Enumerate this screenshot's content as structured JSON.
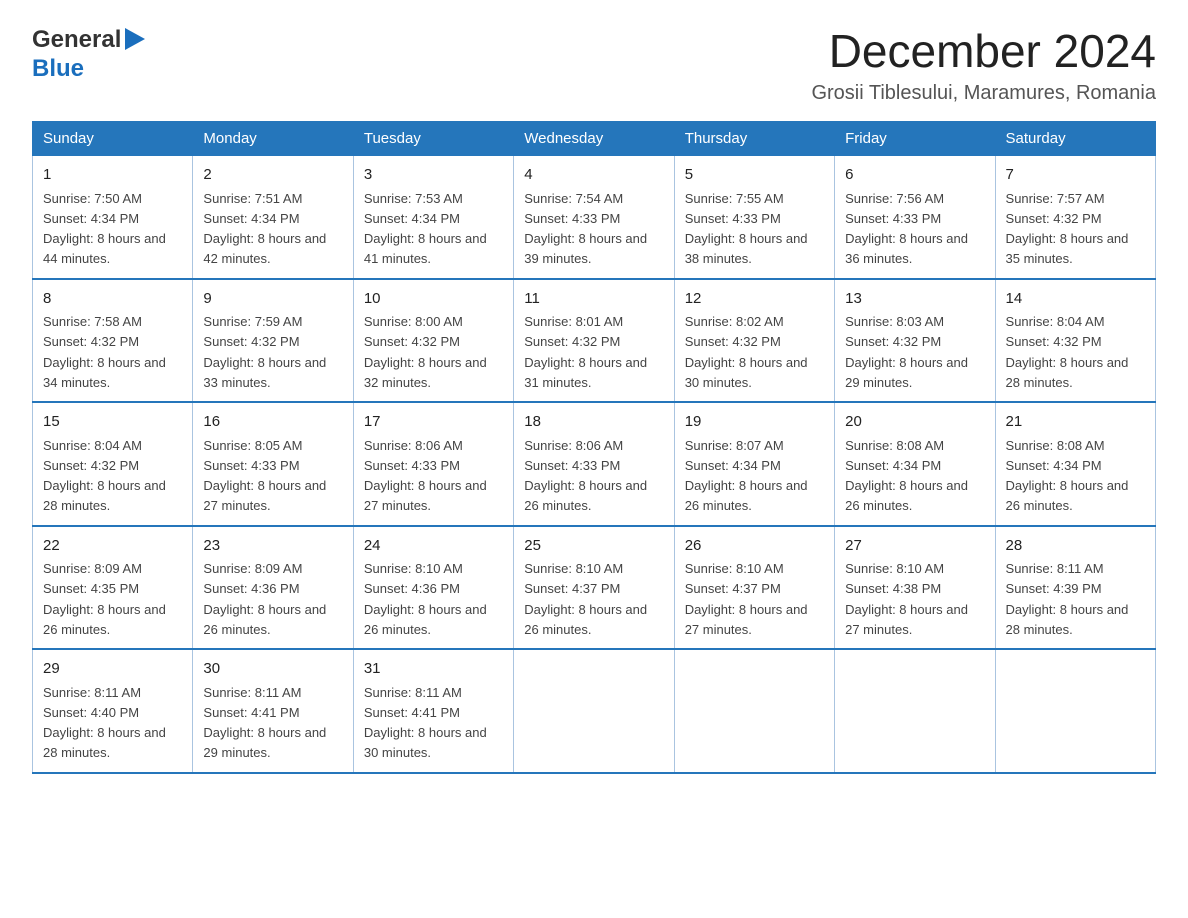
{
  "logo": {
    "general": "General",
    "blue": "Blue"
  },
  "header": {
    "month_year": "December 2024",
    "location": "Grosii Tiblesului, Maramures, Romania"
  },
  "weekdays": [
    "Sunday",
    "Monday",
    "Tuesday",
    "Wednesday",
    "Thursday",
    "Friday",
    "Saturday"
  ],
  "weeks": [
    [
      {
        "day": "1",
        "sunrise": "7:50 AM",
        "sunset": "4:34 PM",
        "daylight": "8 hours and 44 minutes."
      },
      {
        "day": "2",
        "sunrise": "7:51 AM",
        "sunset": "4:34 PM",
        "daylight": "8 hours and 42 minutes."
      },
      {
        "day": "3",
        "sunrise": "7:53 AM",
        "sunset": "4:34 PM",
        "daylight": "8 hours and 41 minutes."
      },
      {
        "day": "4",
        "sunrise": "7:54 AM",
        "sunset": "4:33 PM",
        "daylight": "8 hours and 39 minutes."
      },
      {
        "day": "5",
        "sunrise": "7:55 AM",
        "sunset": "4:33 PM",
        "daylight": "8 hours and 38 minutes."
      },
      {
        "day": "6",
        "sunrise": "7:56 AM",
        "sunset": "4:33 PM",
        "daylight": "8 hours and 36 minutes."
      },
      {
        "day": "7",
        "sunrise": "7:57 AM",
        "sunset": "4:32 PM",
        "daylight": "8 hours and 35 minutes."
      }
    ],
    [
      {
        "day": "8",
        "sunrise": "7:58 AM",
        "sunset": "4:32 PM",
        "daylight": "8 hours and 34 minutes."
      },
      {
        "day": "9",
        "sunrise": "7:59 AM",
        "sunset": "4:32 PM",
        "daylight": "8 hours and 33 minutes."
      },
      {
        "day": "10",
        "sunrise": "8:00 AM",
        "sunset": "4:32 PM",
        "daylight": "8 hours and 32 minutes."
      },
      {
        "day": "11",
        "sunrise": "8:01 AM",
        "sunset": "4:32 PM",
        "daylight": "8 hours and 31 minutes."
      },
      {
        "day": "12",
        "sunrise": "8:02 AM",
        "sunset": "4:32 PM",
        "daylight": "8 hours and 30 minutes."
      },
      {
        "day": "13",
        "sunrise": "8:03 AM",
        "sunset": "4:32 PM",
        "daylight": "8 hours and 29 minutes."
      },
      {
        "day": "14",
        "sunrise": "8:04 AM",
        "sunset": "4:32 PM",
        "daylight": "8 hours and 28 minutes."
      }
    ],
    [
      {
        "day": "15",
        "sunrise": "8:04 AM",
        "sunset": "4:32 PM",
        "daylight": "8 hours and 28 minutes."
      },
      {
        "day": "16",
        "sunrise": "8:05 AM",
        "sunset": "4:33 PM",
        "daylight": "8 hours and 27 minutes."
      },
      {
        "day": "17",
        "sunrise": "8:06 AM",
        "sunset": "4:33 PM",
        "daylight": "8 hours and 27 minutes."
      },
      {
        "day": "18",
        "sunrise": "8:06 AM",
        "sunset": "4:33 PM",
        "daylight": "8 hours and 26 minutes."
      },
      {
        "day": "19",
        "sunrise": "8:07 AM",
        "sunset": "4:34 PM",
        "daylight": "8 hours and 26 minutes."
      },
      {
        "day": "20",
        "sunrise": "8:08 AM",
        "sunset": "4:34 PM",
        "daylight": "8 hours and 26 minutes."
      },
      {
        "day": "21",
        "sunrise": "8:08 AM",
        "sunset": "4:34 PM",
        "daylight": "8 hours and 26 minutes."
      }
    ],
    [
      {
        "day": "22",
        "sunrise": "8:09 AM",
        "sunset": "4:35 PM",
        "daylight": "8 hours and 26 minutes."
      },
      {
        "day": "23",
        "sunrise": "8:09 AM",
        "sunset": "4:36 PM",
        "daylight": "8 hours and 26 minutes."
      },
      {
        "day": "24",
        "sunrise": "8:10 AM",
        "sunset": "4:36 PM",
        "daylight": "8 hours and 26 minutes."
      },
      {
        "day": "25",
        "sunrise": "8:10 AM",
        "sunset": "4:37 PM",
        "daylight": "8 hours and 26 minutes."
      },
      {
        "day": "26",
        "sunrise": "8:10 AM",
        "sunset": "4:37 PM",
        "daylight": "8 hours and 27 minutes."
      },
      {
        "day": "27",
        "sunrise": "8:10 AM",
        "sunset": "4:38 PM",
        "daylight": "8 hours and 27 minutes."
      },
      {
        "day": "28",
        "sunrise": "8:11 AM",
        "sunset": "4:39 PM",
        "daylight": "8 hours and 28 minutes."
      }
    ],
    [
      {
        "day": "29",
        "sunrise": "8:11 AM",
        "sunset": "4:40 PM",
        "daylight": "8 hours and 28 minutes."
      },
      {
        "day": "30",
        "sunrise": "8:11 AM",
        "sunset": "4:41 PM",
        "daylight": "8 hours and 29 minutes."
      },
      {
        "day": "31",
        "sunrise": "8:11 AM",
        "sunset": "4:41 PM",
        "daylight": "8 hours and 30 minutes."
      },
      null,
      null,
      null,
      null
    ]
  ]
}
